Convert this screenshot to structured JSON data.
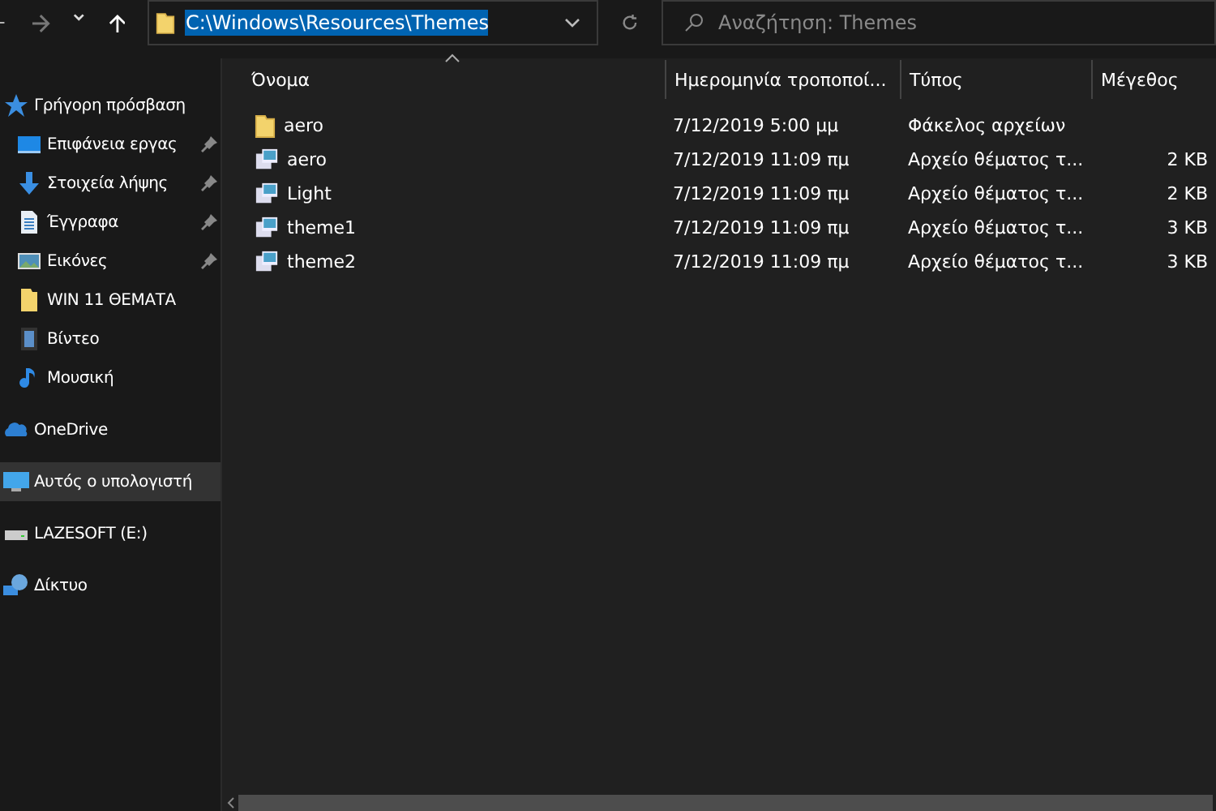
{
  "address": {
    "value": "C:\\Windows\\Resources\\Themes",
    "selected": true
  },
  "search": {
    "placeholder": "Αναζήτηση: Themes"
  },
  "sidebar": {
    "items": [
      {
        "label": "Γρήγορη πρόσβαση",
        "kind": "star",
        "selected": false,
        "children": [
          {
            "label": "Επιφάνεια εργας",
            "kind": "desktop",
            "pinned": true,
            "selected": false
          },
          {
            "label": "Στοιχεία λήψης",
            "kind": "download",
            "pinned": true,
            "selected": false
          },
          {
            "label": "Έγγραφα",
            "kind": "document",
            "pinned": true,
            "selected": false
          },
          {
            "label": "Εικόνες",
            "kind": "pictures",
            "pinned": true,
            "selected": false
          },
          {
            "label": "WIN 11 ΘΕΜΑΤΑ",
            "kind": "folder",
            "pinned": false,
            "selected": false
          },
          {
            "label": "Βίντεο",
            "kind": "video",
            "pinned": false,
            "selected": false
          },
          {
            "label": "Μουσική",
            "kind": "music",
            "pinned": false,
            "selected": false
          }
        ]
      },
      {
        "label": "OneDrive",
        "kind": "cloud",
        "selected": false
      },
      {
        "label": "Αυτός ο υπολογιστή",
        "kind": "pc",
        "selected": true
      },
      {
        "label": "LAZESOFT (E:)",
        "kind": "drive",
        "selected": false
      },
      {
        "label": "Δίκτυο",
        "kind": "network",
        "selected": false
      }
    ]
  },
  "table": {
    "columns": [
      "Όνομα",
      "Ημερομηνία τροποποί...",
      "Τύπος",
      "Μέγεθος"
    ],
    "rows": [
      {
        "kind": "folder",
        "name": "aero",
        "date": "7/12/2019 5:00 μμ",
        "type": "Φάκελος αρχείων"
      },
      {
        "kind": "theme",
        "name": "aero",
        "date": "7/12/2019 11:09 πμ",
        "type": "Αρχείο θέματος τ...",
        "size": "2 KB"
      },
      {
        "kind": "theme",
        "name": "Light",
        "date": "7/12/2019 11:09 πμ",
        "type": "Αρχείο θέματος τ...",
        "size": "2 KB"
      },
      {
        "kind": "theme",
        "name": "theme1",
        "date": "7/12/2019 11:09 πμ",
        "type": "Αρχείο θέματος τ...",
        "size": "3 KB"
      },
      {
        "kind": "theme",
        "name": "theme2",
        "date": "7/12/2019 11:09 πμ",
        "type": "Αρχείο θέματος τ...",
        "size": "3 KB"
      }
    ]
  }
}
